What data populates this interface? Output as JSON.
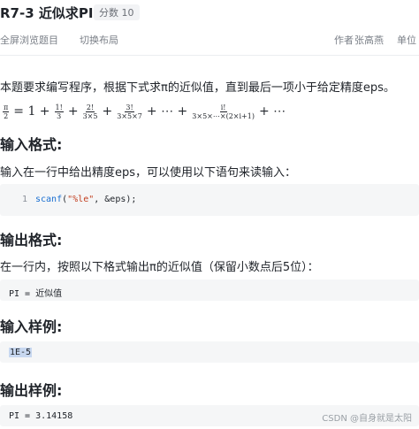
{
  "header": {
    "title": "R7-3 近似求PI",
    "score_badge": "分数 10",
    "fullscreen_label": "全屏浏览题目",
    "switch_layout_label": "切换布局",
    "author_label": "作者",
    "author_name": "张高燕",
    "unit_label": "单位"
  },
  "problem": {
    "intro": "本题要求编写程序，根据下式求π的近似值，直到最后一项小于给定精度eps。",
    "formula": {
      "lhs_num": "π",
      "lhs_den": "2",
      "eq": "= 1 +",
      "t1_num": "1!",
      "t1_den": "3",
      "t2_num": "2!",
      "t2_den": "3×5",
      "t3_num": "3!",
      "t3_den": "3×5×7",
      "dots": "+ ⋯ +",
      "tn_num": "i!",
      "tn_den": "3×5×⋯×(2×i+1)",
      "tail": "+ ⋯"
    }
  },
  "input_section": {
    "heading": "输入格式:",
    "text": "输入在一行中给出精度eps，可以使用以下语句来读输入：",
    "code": {
      "line_no": "1",
      "func": "scanf",
      "open": "(",
      "str": "\"%le\"",
      "rest": ", &eps);"
    }
  },
  "output_section": {
    "heading": "输出格式:",
    "text": "在一行内，按照以下格式输出π的近似值（保留小数点后5位）：",
    "code": "PI = 近似值"
  },
  "sample_input": {
    "heading": "输入样例:",
    "code": "1E-5"
  },
  "sample_output": {
    "heading": "输出样例:",
    "code": "PI = 3.14158"
  },
  "watermark": "CSDN @自身就是太阳"
}
